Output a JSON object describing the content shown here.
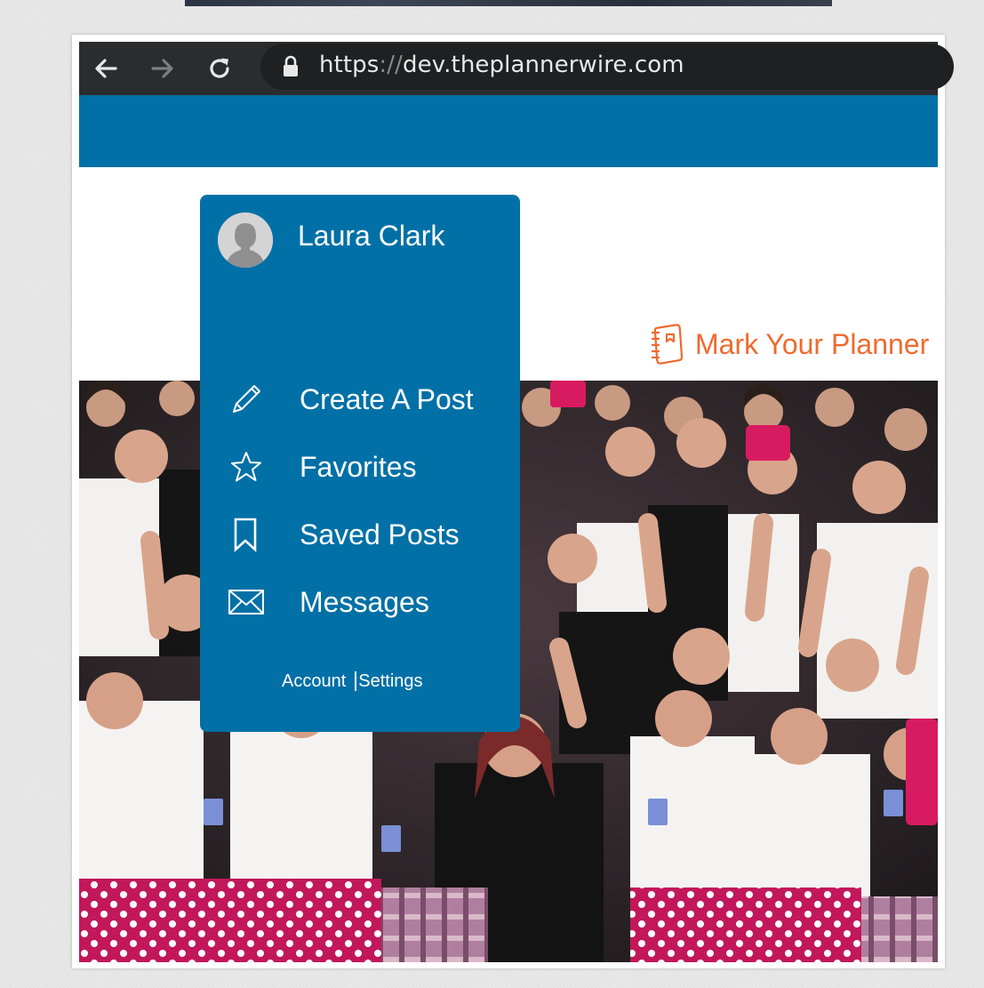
{
  "browser": {
    "url_scheme": "https",
    "url_sep": "://",
    "url_host": "dev.theplannerwire.com",
    "icons": [
      "back-arrow-icon",
      "forward-arrow-icon",
      "reload-icon",
      "lock-icon"
    ]
  },
  "site": {
    "header_color": "#0170a6",
    "mark_planner_label": "Mark Your Planner",
    "accent_color": "#ef6a2e"
  },
  "user_menu": {
    "user_name": "Laura Clark",
    "items": [
      {
        "label": "Create A Post",
        "icon": "pencil-icon"
      },
      {
        "label": "Favorites",
        "icon": "star-icon"
      },
      {
        "label": "Saved Posts",
        "icon": "bookmark-icon"
      },
      {
        "label": "Messages",
        "icon": "envelope-icon"
      }
    ],
    "account_label": "Account",
    "settings_label": "Settings"
  }
}
